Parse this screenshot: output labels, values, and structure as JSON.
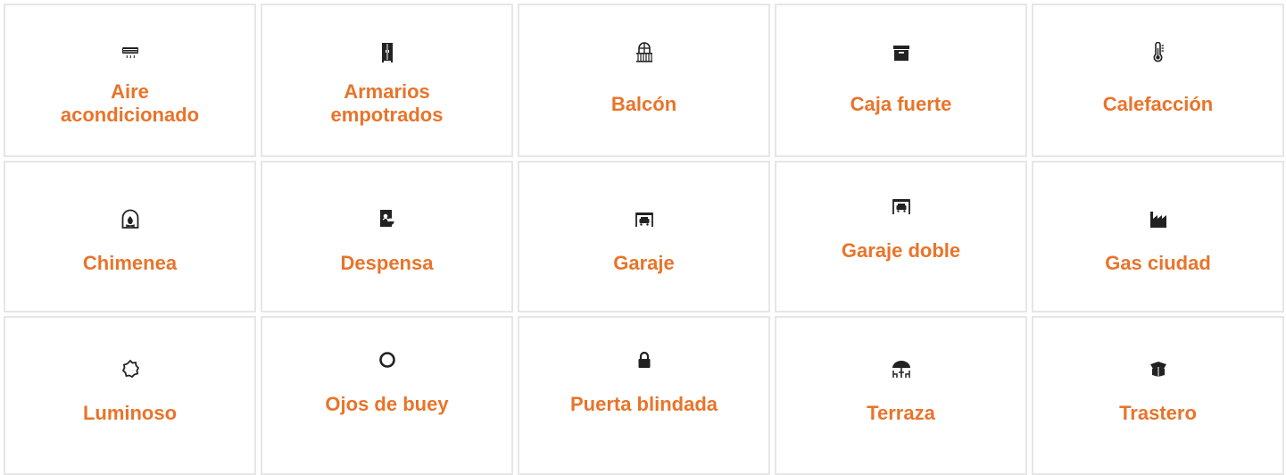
{
  "amenities": [
    {
      "label": "Aire acondicionado",
      "icon": "air-conditioner-icon"
    },
    {
      "label": "Armarios empotrados",
      "icon": "wardrobe-icon"
    },
    {
      "label": "Balcón",
      "icon": "balcony-icon"
    },
    {
      "label": "Caja fuerte",
      "icon": "safe-box-icon"
    },
    {
      "label": "Calefacción",
      "icon": "thermometer-icon"
    },
    {
      "label": "Chimenea",
      "icon": "fireplace-icon"
    },
    {
      "label": "Despensa",
      "icon": "pantry-icon"
    },
    {
      "label": "Garaje",
      "icon": "garage-icon"
    },
    {
      "label": "Garaje doble",
      "icon": "double-garage-icon"
    },
    {
      "label": "Gas ciudad",
      "icon": "factory-icon"
    },
    {
      "label": "Luminoso",
      "icon": "sun-icon"
    },
    {
      "label": "Ojos de buey",
      "icon": "porthole-icon"
    },
    {
      "label": "Puerta blindada",
      "icon": "lock-icon"
    },
    {
      "label": "Terraza",
      "icon": "terrace-icon"
    },
    {
      "label": "Trastero",
      "icon": "storage-box-icon"
    }
  ],
  "colors": {
    "label": "#e8742a",
    "icon": "#222222",
    "border": "#e6e6e6"
  }
}
